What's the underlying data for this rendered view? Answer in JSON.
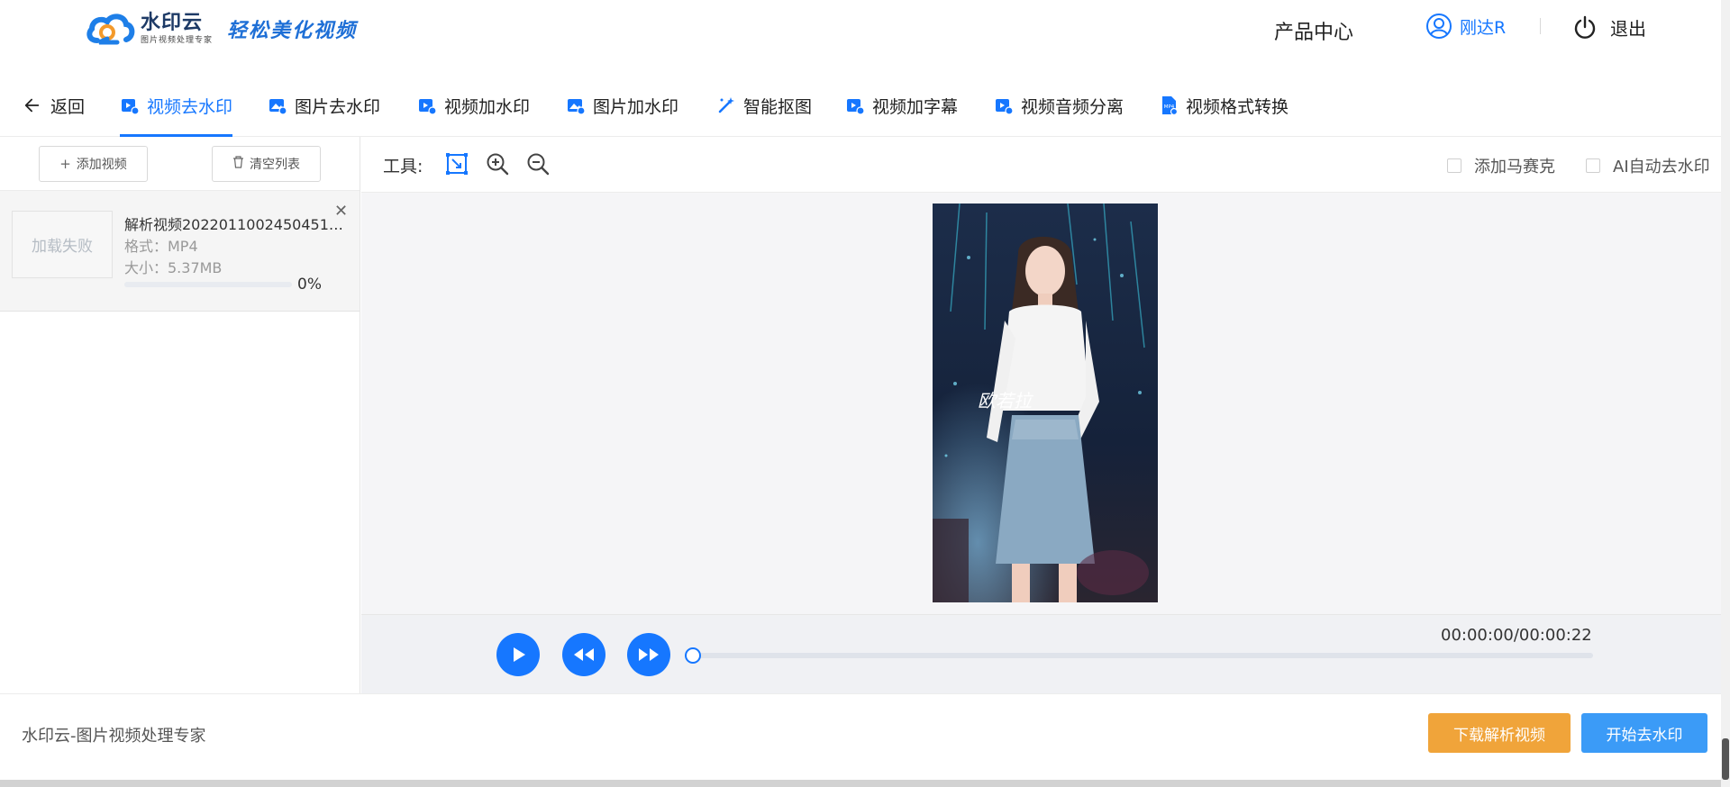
{
  "header": {
    "logo_name": "水印云",
    "logo_sub": "图片视频处理专家",
    "slogan": "轻松美化视频",
    "product_center": "产品中心",
    "username": "刚达R",
    "logout": "退出"
  },
  "tabs": [
    {
      "label": "返回"
    },
    {
      "label": "视频去水印",
      "active": true
    },
    {
      "label": "图片去水印"
    },
    {
      "label": "视频加水印"
    },
    {
      "label": "图片加水印"
    },
    {
      "label": "智能抠图"
    },
    {
      "label": "视频加字幕"
    },
    {
      "label": "视频音频分离"
    },
    {
      "label": "视频格式转换"
    }
  ],
  "left_panel": {
    "add_video": "添加视频",
    "clear_list": "清空列表",
    "file": {
      "thumb_status": "加载失败",
      "name": "解析视频20220110024504514...",
      "format": "格式：MP4",
      "size": "大小：5.37MB",
      "progress": 0,
      "progress_text": "0%"
    }
  },
  "tools": {
    "label": "工具:",
    "add_mosaic": "添加马赛克",
    "ai_auto_remove": "AI自动去水印"
  },
  "video": {
    "overlay_text": "欧若拉",
    "time": "00:00:00/00:00:22",
    "progress": 0
  },
  "footer": {
    "text": "水印云-图片视频处理专家",
    "download_button": "下载解析视频",
    "start_button": "开始去水印"
  },
  "colors": {
    "accent": "#1677ff",
    "orange": "#f0a43a",
    "start_blue": "#3b9bf7"
  }
}
